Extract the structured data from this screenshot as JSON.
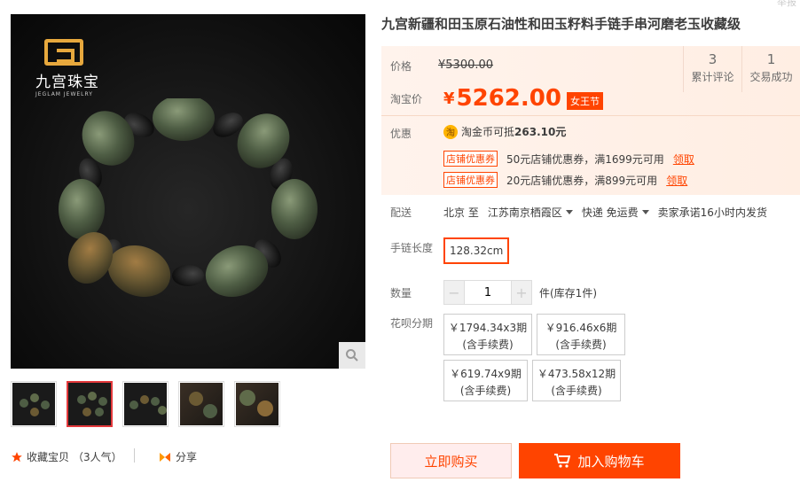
{
  "gallery": {
    "logo_cn": "九宫珠宝",
    "logo_en": "JEGLAM JEWELRY",
    "thumbnails": 5,
    "active_thumbnail": 2
  },
  "actions": {
    "collect_label": "收藏宝贝",
    "collect_count": "（3人气）",
    "share_label": "分享"
  },
  "product": {
    "title": "九宫新疆和田玉原石油性和田玉籽料手链手串河磨老玉收藏级",
    "top_cut": "举报"
  },
  "price": {
    "list_label": "价格",
    "list_price": "¥5300.00",
    "taobao_label": "淘宝价",
    "currency": "¥",
    "current_price": "5262.00",
    "festival_badge": "女王节"
  },
  "stats": [
    {
      "num": "3",
      "label": "累计评论"
    },
    {
      "num": "1",
      "label": "交易成功"
    }
  ],
  "promo": {
    "label": "优惠",
    "coin_icon": "淘",
    "coin_text": "淘金币可抵",
    "coin_amount": "263.10元",
    "coupons": [
      {
        "tag": "店铺优惠券",
        "text": "50元店铺优惠券，满1699元可用",
        "action": "领取"
      },
      {
        "tag": "店铺优惠券",
        "text": "20元店铺优惠券，满899元可用",
        "action": "领取"
      }
    ]
  },
  "delivery": {
    "label": "配送",
    "from": "北京 至",
    "to": "江苏南京栖霞区",
    "method": "快递 免运费",
    "promise": "卖家承诺16小时内发货"
  },
  "sku": {
    "label": "手链长度",
    "option": "128.32cm"
  },
  "quantity": {
    "label": "数量",
    "value": "1",
    "stock": "件(库存1件)"
  },
  "installments": {
    "label": "花呗分期",
    "options": [
      {
        "line1": "￥1794.34x3期",
        "line2": "(含手续费)"
      },
      {
        "line1": "￥916.46x6期",
        "line2": "(含手续费)"
      },
      {
        "line1": "￥619.74x9期",
        "line2": "(含手续费)"
      },
      {
        "line1": "￥473.58x12期",
        "line2": "(含手续费)"
      }
    ]
  },
  "buttons": {
    "buy_now": "立即购买",
    "add_cart": "加入购物车"
  },
  "colors": {
    "accent": "#ff4400",
    "price_bg": "#fff3ec",
    "gold": "#e7a83d"
  }
}
